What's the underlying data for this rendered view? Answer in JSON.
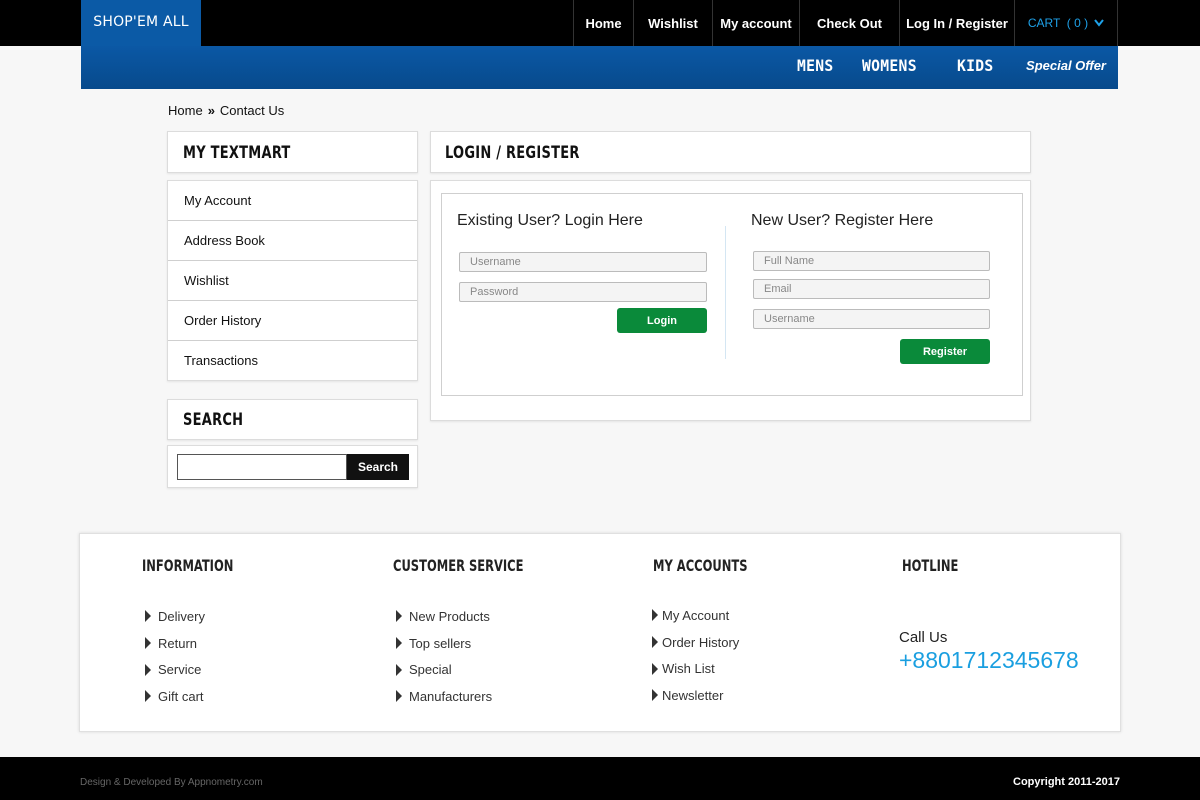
{
  "brand": {
    "logo": "SHOP'EM ALL"
  },
  "topnav": {
    "home": "Home",
    "wishlist": "Wishlist",
    "my_account": "My account",
    "checkout": "Check Out",
    "login_register": "Log In / Register",
    "cart": "CART  ( 0 )"
  },
  "catnav": {
    "mens": "MENS",
    "womens": "WOMENS",
    "kids": "KIDS",
    "special": "Special Offer"
  },
  "breadcrumb": {
    "home": "Home",
    "sep": "»",
    "current": "Contact Us"
  },
  "sidebar": {
    "title": "MY TEXTMART",
    "items": [
      "My Account",
      "Address Book",
      "Wishlist",
      "Order History",
      "Transactions"
    ]
  },
  "search": {
    "title": "SEARCH",
    "button": "Search",
    "placeholder": ""
  },
  "main": {
    "title": "LOGIN / REGISTER",
    "login": {
      "heading": "Existing User? Login Here",
      "username_placeholder": "Username",
      "password_placeholder": "Password",
      "button": "Login"
    },
    "register": {
      "heading": "New User? Register Here",
      "fullname_placeholder": "Full Name",
      "email_placeholder": "Email",
      "username_placeholder": "Username",
      "button": "Register"
    }
  },
  "footer": {
    "information": {
      "title": "INFORMATION",
      "items": [
        "Delivery",
        "Return",
        "Service",
        "Gift cart"
      ]
    },
    "customer_service": {
      "title": "CUSTOMER SERVICE",
      "items": [
        "New Products",
        "Top sellers",
        "Special",
        "Manufacturers"
      ]
    },
    "my_accounts": {
      "title": "MY ACCOUNTS",
      "items": [
        "My Account",
        "Order History",
        "Wish List",
        "Newsletter"
      ]
    },
    "hotline": {
      "title": "HOTLINE",
      "call_label": "Call Us",
      "phone": "+8801712345678"
    }
  },
  "bottom": {
    "credit": "Design & Developed By Appnometry.com",
    "copyright": "Copyright 2011-2017"
  },
  "colors": {
    "brand_blue": "#0b5aa6",
    "button_green": "#0a8a3a",
    "phone_blue": "#1a9fe0",
    "cart_blue": "#1ea1e8"
  }
}
